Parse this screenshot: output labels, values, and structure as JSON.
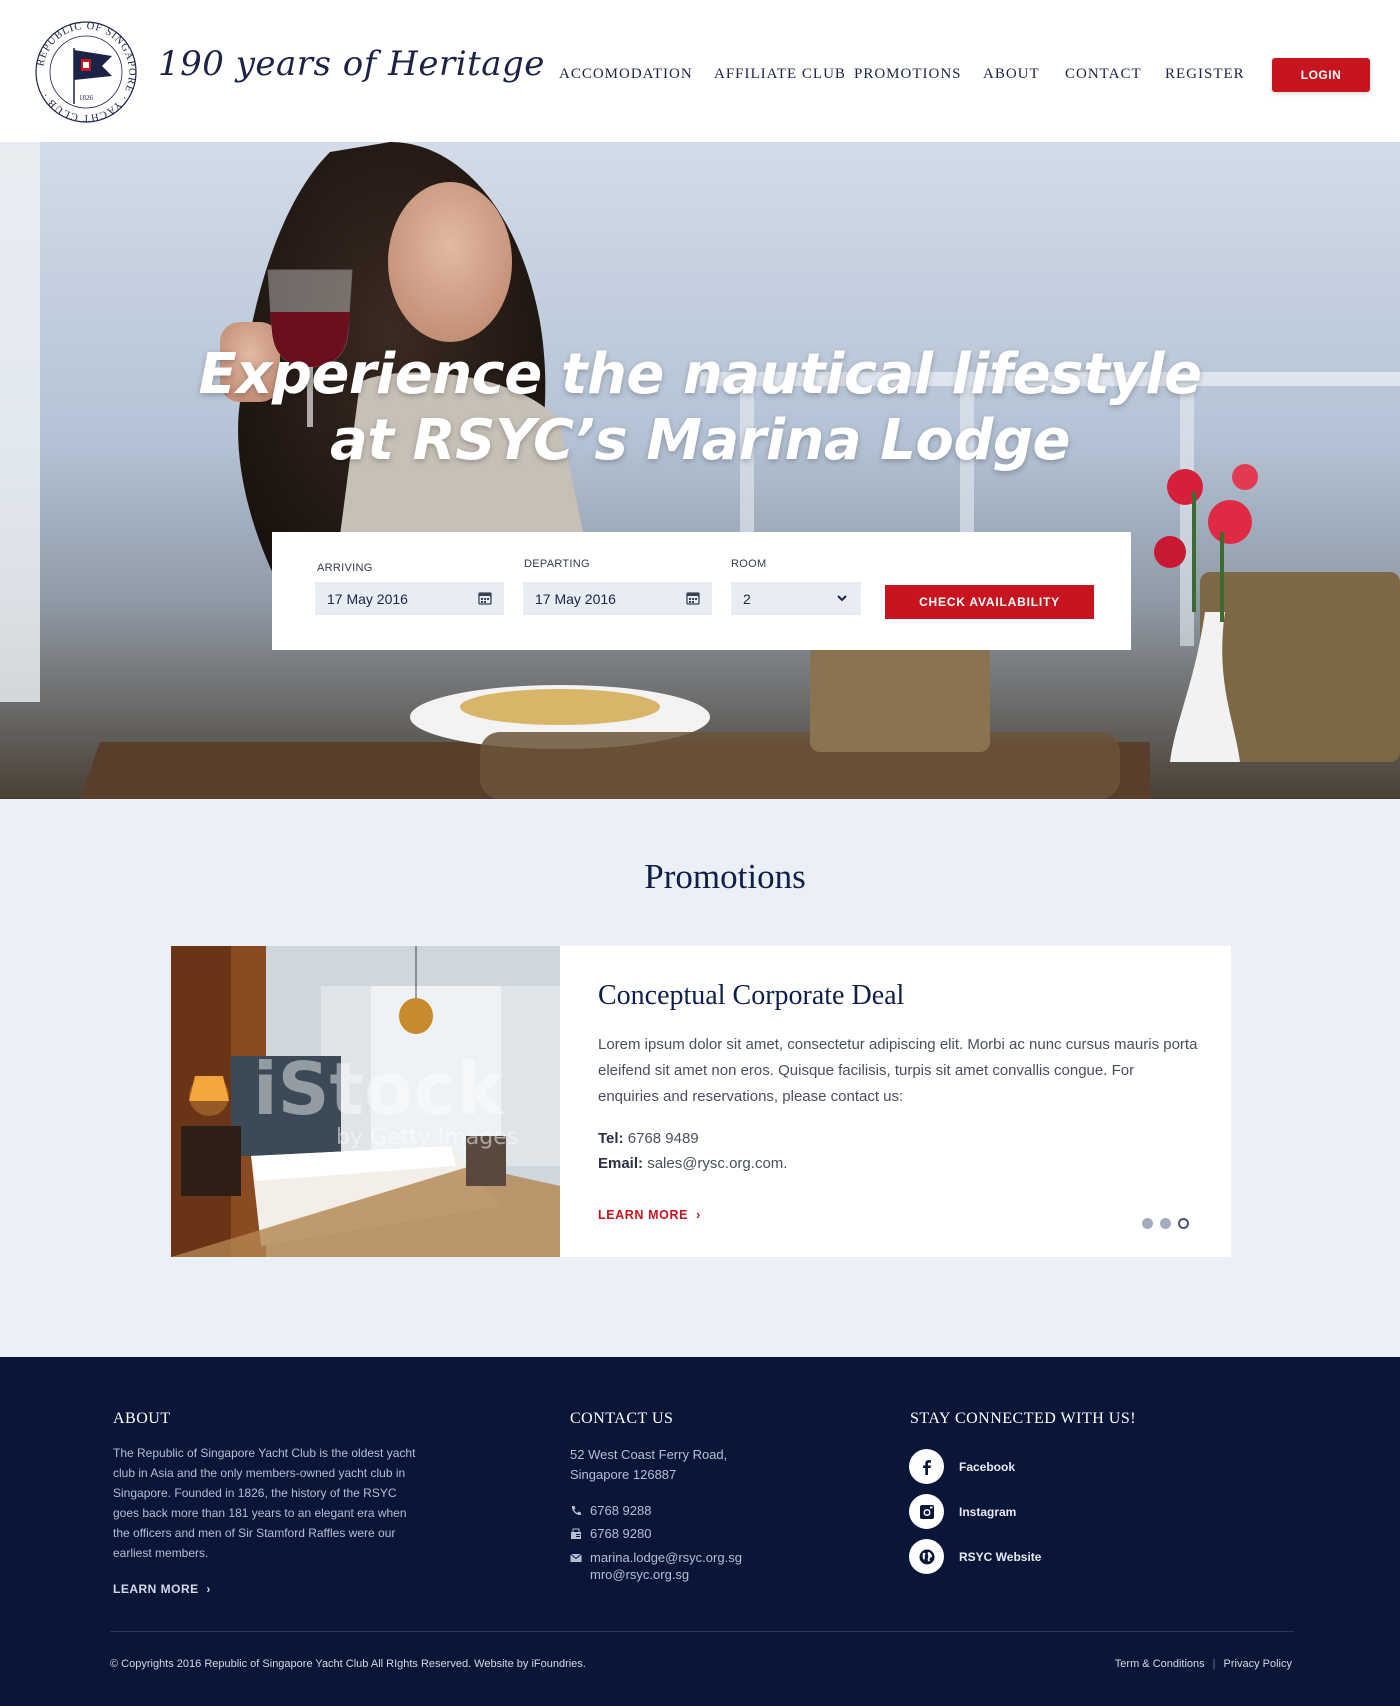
{
  "header": {
    "logo_ring_text": "REPUBLIC OF SINGAPORE YACHT CLUB",
    "logo_year": "1826",
    "tagline": "190 years of Heritage",
    "nav": [
      "ACCOMODATION",
      "AFFILIATE CLUB",
      "PROMOTIONS",
      "ABOUT",
      "CONTACT",
      "REGISTER"
    ],
    "login_label": "LOGIN"
  },
  "hero": {
    "title_line1": "Experience the nautical lifestyle",
    "title_line2": "at RSYC’s Marina Lodge",
    "booking": {
      "arriving_label": "ARRIVING",
      "arriving_value": "17 May 2016",
      "departing_label": "DEPARTING",
      "departing_value": "17 May 2016",
      "room_label": "ROOM",
      "room_value": "2",
      "check_label": "CHECK AVAILABILITY"
    }
  },
  "promotions": {
    "title": "Promotions",
    "image_watermark": "iStock",
    "image_watermark_sub": "by Getty Images",
    "card": {
      "heading": "Conceptual Corporate Deal",
      "text": "Lorem ipsum dolor sit amet, consectetur adipiscing elit. Morbi ac nunc cursus mauris porta eleifend sit amet non eros. Quisque facilisis, turpis sit amet convallis congue. For enquiries and reservations, please contact us:",
      "tel_label": "Tel:",
      "tel_value": "6768 9489",
      "email_label": "Email:",
      "email_value": "sales@rysc.org.com.",
      "learn_more": "LEARN MORE",
      "slides_total": 3,
      "active_slide": 3
    }
  },
  "footer": {
    "about": {
      "heading": "ABOUT",
      "text": "The Republic of Singapore Yacht Club is the oldest yacht club in Asia and the only members-owned yacht club in Singapore. Founded in 1826, the history of the RSYC goes back more than 181 years to an elegant era when the officers and men of Sir Stamford Raffles were our earliest members.",
      "learn_more": "LEARN MORE"
    },
    "contact": {
      "heading": "CONTACT US",
      "address_line1": "52 West Coast Ferry Road,",
      "address_line2": "Singapore 126887",
      "phone": "6768 9288",
      "fax": "6768 9280",
      "email1": "marina.lodge@rsyc.org.sg",
      "email2": "mro@rsyc.org.sg"
    },
    "social": {
      "heading": "STAY CONNECTED WITH US!",
      "facebook": "Facebook",
      "instagram": "Instagram",
      "website": "RSYC Website"
    },
    "copyright": "© Copyrights 2016 Republic of Singapore Yacht Club All RIghts Reserved. Website by iFoundries.",
    "terms": "Term & Conditions",
    "privacy": "Privacy Policy"
  },
  "colors": {
    "brand_red": "#c8141e",
    "navy": "#0a1638",
    "light_bg": "#ebeff6"
  }
}
